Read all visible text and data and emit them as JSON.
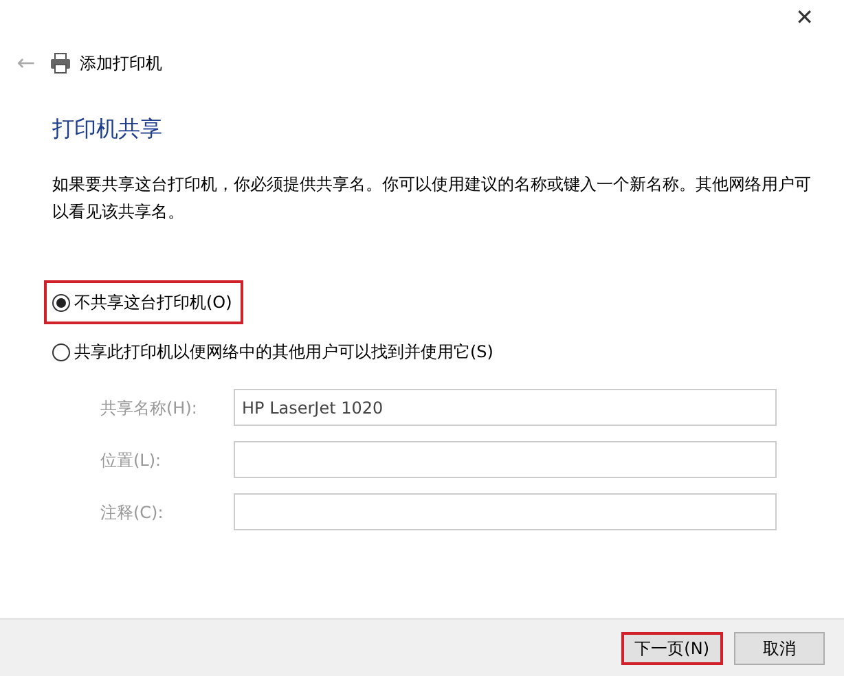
{
  "window": {
    "title": "添加打印机",
    "close": "✕",
    "back": "←"
  },
  "heading": "打印机共享",
  "description": "如果要共享这台打印机，你必须提供共享名。你可以使用建议的名称或键入一个新名称。其他网络用户可以看见该共享名。",
  "options": [
    {
      "label": "不共享这台打印机(O)",
      "selected": true,
      "highlighted": true
    },
    {
      "label": "共享此打印机以便网络中的其他用户可以找到并使用它(S)",
      "selected": false,
      "highlighted": false
    }
  ],
  "fields": [
    {
      "label": "共享名称(H):",
      "value": "HP LaserJet 1020",
      "disabled": true
    },
    {
      "label": "位置(L):",
      "disabled": true
    },
    {
      "label": "注释(C):",
      "disabled": true
    }
  ],
  "buttons": [
    {
      "label": "下一页(N)",
      "highlighted": true
    },
    {
      "label": "取消",
      "highlighted": false
    }
  ]
}
